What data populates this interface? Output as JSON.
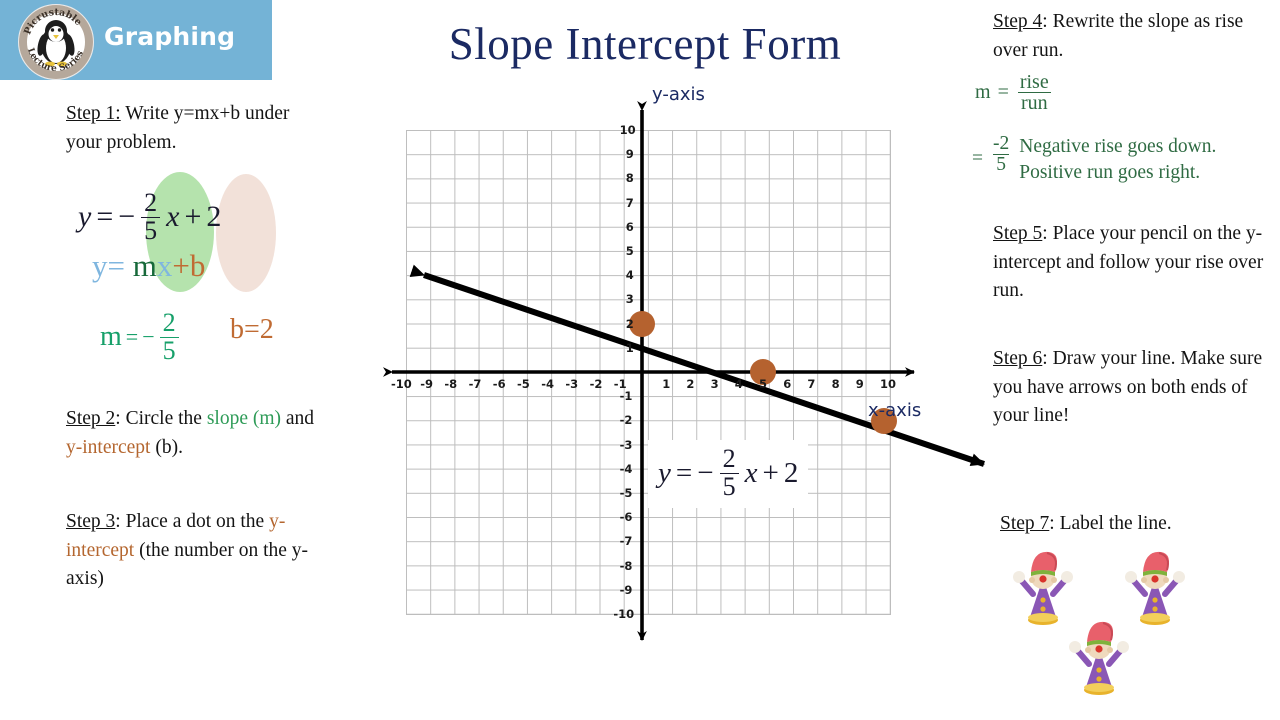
{
  "header": {
    "title": "Graphing",
    "banner_color": "#74b3d6",
    "logo": {
      "icon": "penguin-logo-icon",
      "top_text": "Picrustable",
      "bottom_text": "Lecture Series"
    }
  },
  "page_title": "Slope Intercept Form",
  "colors": {
    "title_navy": "#1b2a63",
    "slope_green": "#17a06a",
    "intercept_brown": "#c06b33",
    "slope_highlight": "#b5e3ad",
    "intercept_highlight": "#f2e1d9",
    "point_dot": "#b5622f",
    "line_black": "#000000"
  },
  "steps": {
    "step1": {
      "heading": "Step 1:",
      "body": " Write y=mx+b under your problem."
    },
    "step2": {
      "heading": "Step 2",
      "part1": ": Circle the ",
      "word_slope": "slope",
      "part2": " (m)",
      "part3": " and ",
      "word_intercept": "y-intercept",
      "part4": " (b)."
    },
    "step3": {
      "heading": "Step 3",
      "part1": ": Place a dot on the ",
      "word_intercept": "y-intercept",
      "part2": " (the number on the y-axis)"
    },
    "step4": {
      "heading": "Step 4",
      "body": ": Rewrite the slope as rise over run."
    },
    "step5": {
      "heading": "Step 5",
      "body": ": Place your pencil on the y-intercept and follow your rise over run."
    },
    "step6": {
      "heading": "Step 6",
      "body": ": Draw your line. Make sure you have arrows on both ends of your line!"
    },
    "step7": {
      "heading": "Step 7",
      "body": ": Label the line."
    }
  },
  "equation": {
    "y": "y",
    "equals": "=",
    "minus": "−",
    "numerator": "2",
    "denominator": "5",
    "x": "x",
    "plus": "+",
    "constant": "2"
  },
  "formula": {
    "y": "y",
    "equals": "=",
    "m": "m",
    "x": "x",
    "plus_b": "+b"
  },
  "values": {
    "m_label": "m",
    "m_equals": "=",
    "m_sign": "−",
    "m_num": "2",
    "m_den": "5",
    "b_text": "b=2"
  },
  "rise_over_run": {
    "m_label": "m",
    "equals": "=",
    "numerator": "rise",
    "denominator": "run",
    "second_equals": "=",
    "neg_num": "-2",
    "neg_den": "5",
    "note_rise": "Negative rise goes down.",
    "note_run": "Positive run goes right."
  },
  "graph": {
    "y_axis_label": "y-axis",
    "x_axis_label": "x-axis",
    "x_ticks": [
      "-10",
      "-9",
      "-8",
      "-7",
      "-6",
      "-5",
      "-4",
      "-3",
      "-2",
      "-1",
      "1",
      "2",
      "3",
      "4",
      "5",
      "6",
      "7",
      "8",
      "9",
      "10"
    ],
    "y_ticks": [
      "10",
      "9",
      "8",
      "7",
      "6",
      "5",
      "4",
      "3",
      "2",
      "1",
      "-1",
      "-2",
      "-3",
      "-4",
      "-5",
      "-6",
      "-7",
      "-8",
      "-9",
      "-10"
    ],
    "equation_label": {
      "y": "y",
      "equals": "=",
      "minus": "−",
      "numerator": "2",
      "denominator": "5",
      "x": "x",
      "plus": "+",
      "constant": "2"
    }
  },
  "chart_data": {
    "type": "line",
    "title": "Slope Intercept Form",
    "xlabel": "x-axis",
    "ylabel": "y-axis",
    "xlim": [
      -10,
      10
    ],
    "ylim": [
      -10,
      10
    ],
    "grid": true,
    "legend": "none",
    "series": [
      {
        "name": "y = -2/5 x + 2",
        "slope": -0.4,
        "intercept": 2,
        "equation": "y = -2/5 x + 2",
        "color": "#000000",
        "arrows": "both",
        "x": [
          -10,
          10
        ],
        "y": [
          6,
          -2
        ]
      }
    ],
    "points": [
      {
        "label": "y-intercept",
        "x": 0,
        "y": 2,
        "color": "#b5622f"
      },
      {
        "label": "rise over run step 1",
        "x": 5,
        "y": 0,
        "color": "#b5622f"
      },
      {
        "label": "rise over run step 2",
        "x": 10,
        "y": -2,
        "color": "#b5622f"
      }
    ]
  }
}
